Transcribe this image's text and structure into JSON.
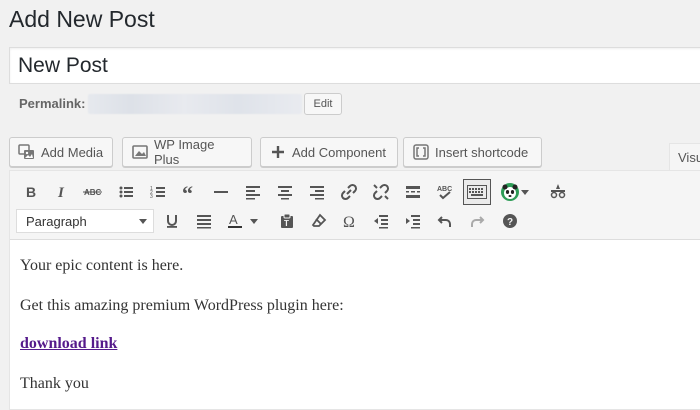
{
  "page": {
    "title": "Add New Post"
  },
  "post": {
    "title_value": "New Post"
  },
  "permalink": {
    "label": "Permalink:",
    "edit_label": "Edit"
  },
  "media_buttons": {
    "add_media": "Add Media",
    "wp_image_plus": "WP Image Plus",
    "add_component": "Add Component",
    "insert_shortcode": "Insert shortcode"
  },
  "editor_tabs": {
    "visual": "Visual"
  },
  "toolbar": {
    "format_select": "Paragraph",
    "row1_icons": [
      "bold-icon",
      "italic-icon",
      "strikethrough-icon",
      "bullet-list-icon",
      "numbered-list-icon",
      "blockquote-icon",
      "horizontal-line-icon",
      "align-left-icon",
      "align-center-icon",
      "align-right-icon",
      "link-icon",
      "unlink-icon",
      "read-more-icon",
      "spellcheck-icon",
      "toolbar-toggle-icon",
      "panda-icon",
      "panda-dropdown-icon",
      "plugin-icon"
    ],
    "row2_icons": [
      "underline-icon",
      "justify-icon",
      "text-color-icon",
      "text-color-dropdown-icon",
      "paste-text-icon",
      "clear-formatting-icon",
      "special-character-icon",
      "outdent-icon",
      "indent-icon",
      "undo-icon",
      "redo-icon",
      "help-icon"
    ]
  },
  "content": {
    "p1": "Your epic content is here.",
    "p2": "Get this amazing premium WordPress plugin here:",
    "link": "download link",
    "p4": "Thank you"
  },
  "colors": {
    "link": "#551a8b",
    "icon": "#555555",
    "background": "#f1f1f1"
  }
}
